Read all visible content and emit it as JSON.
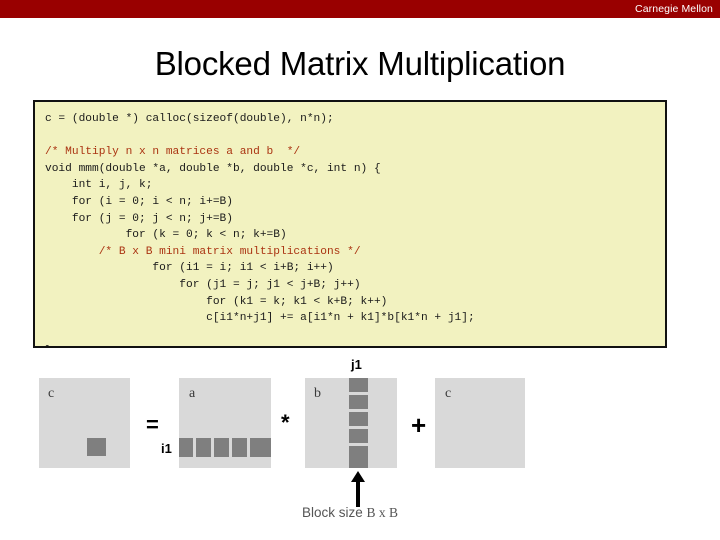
{
  "header": {
    "brand": "Carnegie Mellon",
    "band_color": "#990000"
  },
  "title": "Blocked Matrix Multiplication",
  "code": {
    "background_color": "#f2f2c0",
    "border_color": "#111111",
    "comment_color": "#aa3311",
    "line_01": "c = (double *) calloc(sizeof(double), n*n);",
    "line_02": "",
    "line_03_comment": "/* Multiply n x n matrices a and b  */",
    "line_04": "void mmm(double *a, double *b, double *c, int n) {",
    "line_05": "    int i, j, k;",
    "line_06": "    for (i = 0; i < n; i+=B)",
    "line_07": "    for (j = 0; j < n; j+=B)",
    "line_08": "            for (k = 0; k < n; k+=B)",
    "line_09_comment": "        /* B x B mini matrix multiplications */",
    "line_10": "                for (i1 = i; i1 < i+B; i++)",
    "line_11": "                    for (j1 = j; j1 < j+B; j++)",
    "line_12": "                        for (k1 = k; k1 < k+B; k++)",
    "line_13": "                        c[i1*n+j1] += a[i1*n + k1]*b[k1*n + j1];",
    "line_14": "",
    "line_15": "}"
  },
  "diagram": {
    "matrix_fill": "#d9d9d9",
    "block_fill": "#7f7f7f",
    "label_c_left": "c",
    "label_a": "a",
    "label_b": "b",
    "label_c_right": "c",
    "op_equals": "=",
    "op_times": "*",
    "op_plus": "+",
    "index_i1": "i1",
    "index_j1": "j1",
    "caption_text": "Block size",
    "caption_bxb": "B x B"
  }
}
